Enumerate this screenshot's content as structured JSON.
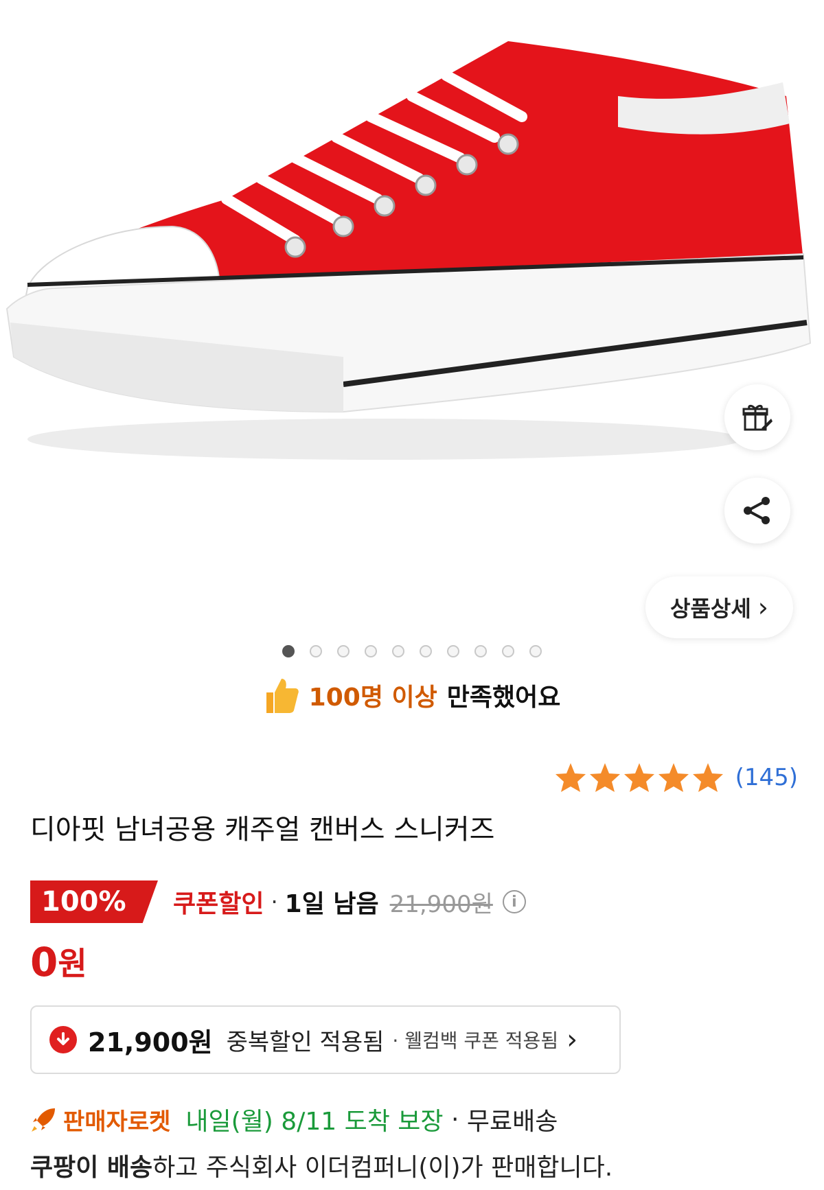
{
  "product_image": {
    "alt": "",
    "shoe_color": "#e4141b"
  },
  "actions": {
    "gift_icon": "gift-rocket-icon",
    "share_icon": "share-icon",
    "detail_label": "상품상세",
    "detail_chevron": "›"
  },
  "carousel": {
    "count": 10,
    "active_index": 0
  },
  "satisfaction": {
    "highlight": "100명 이상",
    "text": "만족했어요"
  },
  "rating": {
    "stars": 5,
    "review_count": "(145)",
    "star_color": "#f48b2a"
  },
  "product": {
    "title": "디아핏 남녀공용 캐주얼 캔버스 스니커즈"
  },
  "pricing": {
    "discount_badge": "100%",
    "coupon_label": "쿠폰할인",
    "separator": "·",
    "remaining": "1일 남음",
    "original_price": "21,900원",
    "info_icon": "i",
    "final_price_number": "0",
    "final_price_unit": "원"
  },
  "extra_discount": {
    "price": "21,900원",
    "label": "중복할인 적용됨",
    "sub": "· 웰컴백 쿠폰 적용됨",
    "chevron": "›"
  },
  "delivery": {
    "rocket_label": "판매자로켓",
    "arrival": "내일(월) 8/11 도착 보장",
    "separator": " · ",
    "shipping": "무료배송"
  },
  "seller": {
    "delivered_by": "쿠팡이 배송",
    "rest": "하고 주식회사 이더컴퍼니(이)가 판매합니다."
  },
  "colors": {
    "accent_red": "#d71a1a",
    "rocket_orange": "#e25a00",
    "delivery_green": "#1a9a3a",
    "link_blue": "#2f6fd6"
  }
}
